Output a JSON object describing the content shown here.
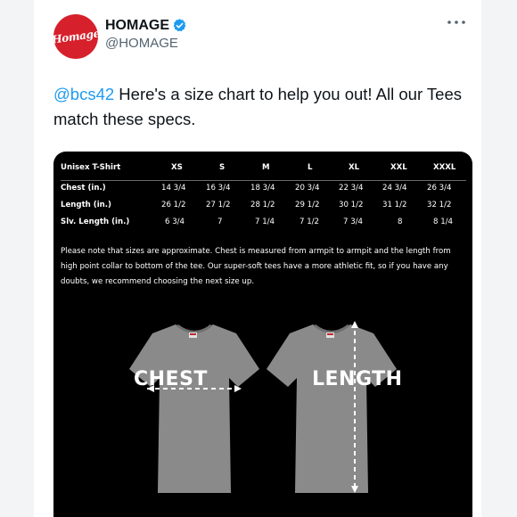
{
  "account": {
    "name": "HOMAGE",
    "handle": "@HOMAGE",
    "avatar_text": "Homage"
  },
  "tweet": {
    "mention": "@bcs42",
    "text": " Here's a size chart to help you out! All our Tees match these specs."
  },
  "size_chart": {
    "title": "Unisex T-Shirt",
    "sizes": [
      "XS",
      "S",
      "M",
      "L",
      "XL",
      "XXL",
      "XXXL"
    ],
    "rows": [
      {
        "label": "Chest (in.)",
        "values": [
          "14 3/4",
          "16 3/4",
          "18 3/4",
          "20 3/4",
          "22 3/4",
          "24 3/4",
          "26 3/4"
        ]
      },
      {
        "label": "Length (in.)",
        "values": [
          "26 1/2",
          "27 1/2",
          "28 1/2",
          "29 1/2",
          "30 1/2",
          "31 1/2",
          "32 1/2"
        ]
      },
      {
        "label": "Slv. Length (in.)",
        "values": [
          "6 3/4",
          "7",
          "7 1/4",
          "7 1/2",
          "7 3/4",
          "8",
          "8 1/4"
        ]
      }
    ],
    "note": "Please note that sizes are approximate. Chest is measured from armpit to armpit and the length from high point collar to bottom of the tee. Our super-soft tees have a more athletic fit, so if you have any doubts, we recommend choosing the next size up."
  },
  "diagrams": {
    "chest_label": "CHEST",
    "length_label": "LENGTH"
  },
  "colors": {
    "brand_red": "#d6202b",
    "link_blue": "#1d9bf0",
    "verified_blue": "#1d9bf0",
    "shirt_gray": "#8a8a8a"
  }
}
